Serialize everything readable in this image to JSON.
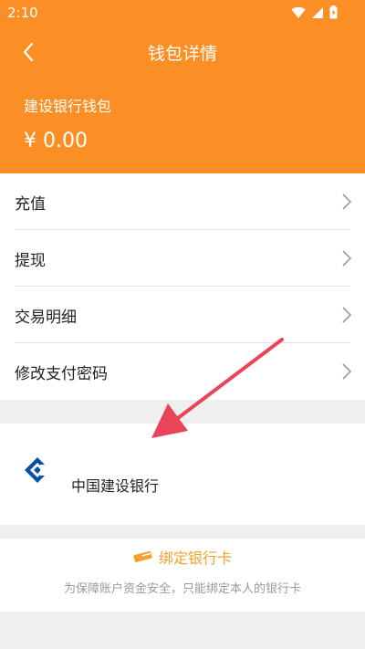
{
  "status_bar": {
    "time": "2:10"
  },
  "nav": {
    "title": "钱包详情"
  },
  "wallet": {
    "name": "建设银行钱包",
    "balance": "¥ 0.00"
  },
  "menu": [
    {
      "label": "充值"
    },
    {
      "label": "提现"
    },
    {
      "label": "交易明细"
    },
    {
      "label": "修改支付密码"
    }
  ],
  "bank_card": {
    "bank_name": "中国建设银行"
  },
  "bind_card": {
    "label": "绑定银行卡",
    "hint": "为保障账户资金安全，只能绑定本人的银行卡"
  },
  "colors": {
    "brand": "#fb8f25",
    "accent": "#f5a02e",
    "annotation_arrow": "#e9445a"
  }
}
